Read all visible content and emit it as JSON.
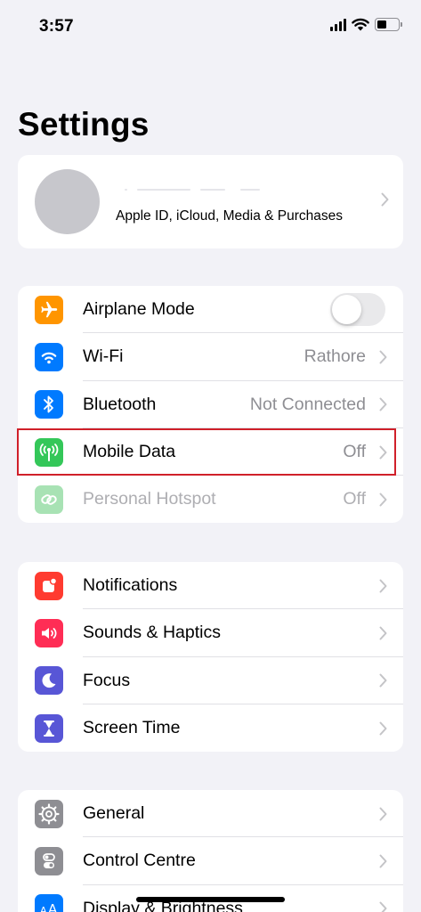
{
  "status_bar": {
    "time": "3:57",
    "signal_icon": "cellular-signal-icon",
    "wifi_icon": "wifi-icon",
    "battery_icon": "battery-icon",
    "battery_level": 0.45
  },
  "header": {
    "title": "Settings"
  },
  "profile": {
    "subtitle": "Apple ID, iCloud, Media & Purchases"
  },
  "connectivity": [
    {
      "label": "Airplane Mode",
      "icon": "airplane-icon",
      "color": "#ff9500",
      "toggle": false
    },
    {
      "label": "Wi-Fi",
      "icon": "wifi-icon",
      "color": "#007aff",
      "value": "Rathore"
    },
    {
      "label": "Bluetooth",
      "icon": "bluetooth-icon",
      "color": "#007aff",
      "value": "Not Connected"
    },
    {
      "label": "Mobile Data",
      "icon": "antenna-icon",
      "color": "#34c759",
      "value": "Off",
      "highlighted": true,
      "highlight_color": "#d0202a"
    },
    {
      "label": "Personal Hotspot",
      "icon": "link-icon",
      "color": "#a8e2b4",
      "value": "Off",
      "dimmed": true
    }
  ],
  "notifications_group": [
    {
      "label": "Notifications",
      "icon": "bell-icon",
      "color": "#ff3b30"
    },
    {
      "label": "Sounds & Haptics",
      "icon": "speaker-icon",
      "color": "#ff2d55"
    },
    {
      "label": "Focus",
      "icon": "moon-icon",
      "color": "#5856d6"
    },
    {
      "label": "Screen Time",
      "icon": "hourglass-icon",
      "color": "#5856d6"
    }
  ],
  "general_group": [
    {
      "label": "General",
      "icon": "gear-icon",
      "color": "#8e8e93"
    },
    {
      "label": "Control Centre",
      "icon": "toggles-icon",
      "color": "#8e8e93"
    },
    {
      "label": "Display & Brightness",
      "icon": "text-size-icon",
      "color": "#007aff"
    }
  ]
}
